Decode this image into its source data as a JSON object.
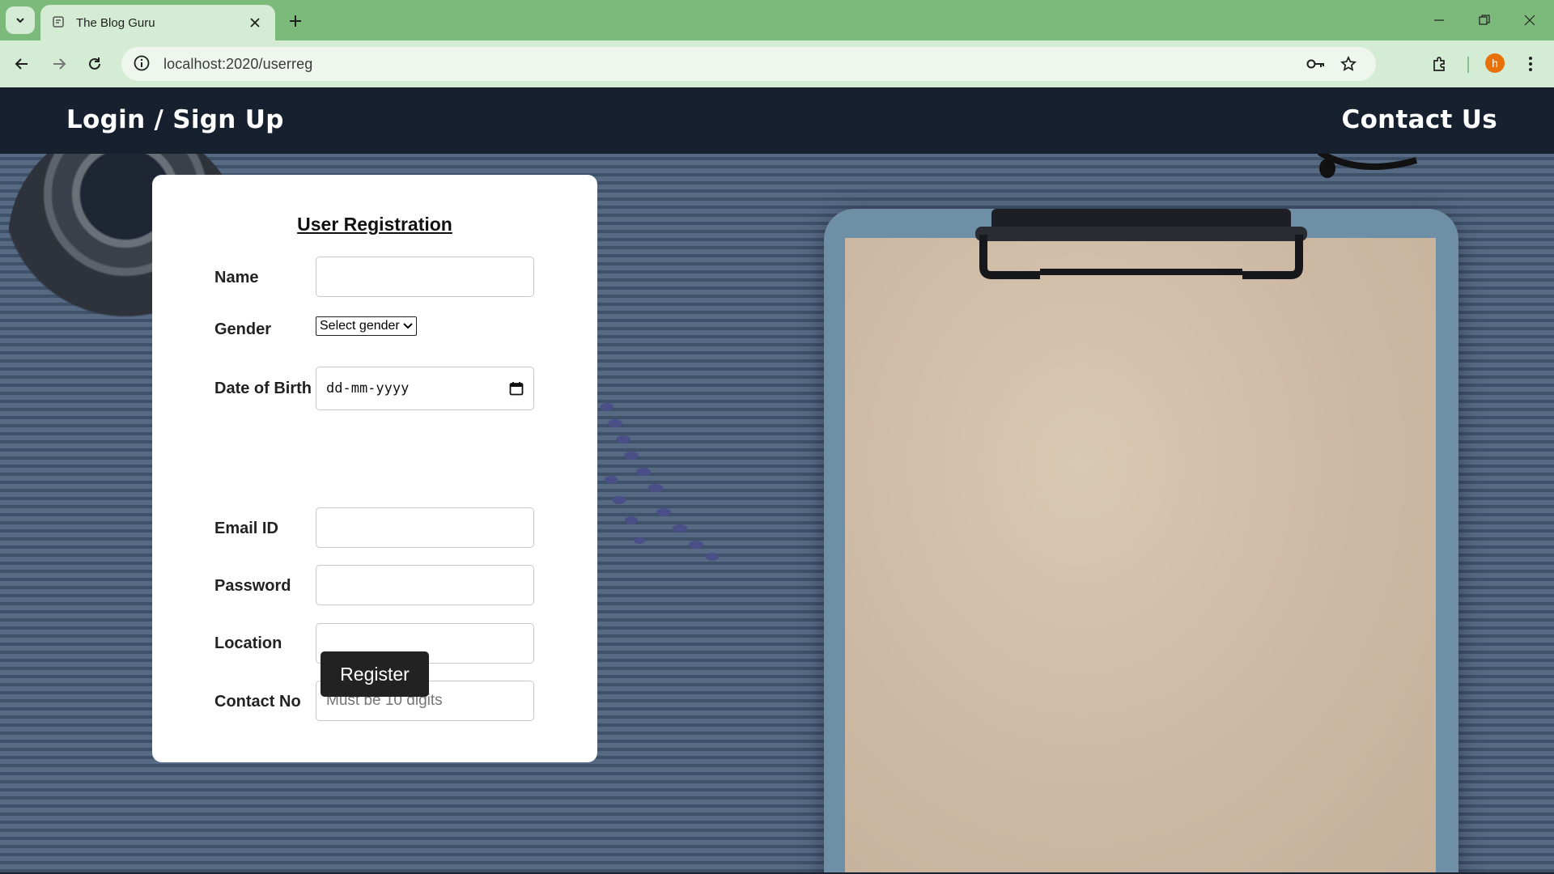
{
  "browser": {
    "tab_title": "The Blog Guru",
    "url": "localhost:2020/userreg",
    "profile_initial": "h"
  },
  "site": {
    "nav_login": "Login / Sign Up",
    "nav_contact": "Contact Us"
  },
  "form": {
    "title": "User Registration",
    "name_label": "Name",
    "gender_label": "Gender",
    "gender_selected": "Select gender",
    "dob_label": "Date of Birth",
    "dob_value": "dd-mm-yyyy",
    "email_label": "Email ID",
    "password_label": "Password",
    "location_label": "Location",
    "contact_label": "Contact No",
    "contact_placeholder": "Must be 10 digits",
    "register_label": "Register"
  },
  "colors": {
    "browser_accent": "#7cba7c",
    "toolbar": "#d4ecd3",
    "site_nav": "#17202f",
    "button": "#222222"
  }
}
